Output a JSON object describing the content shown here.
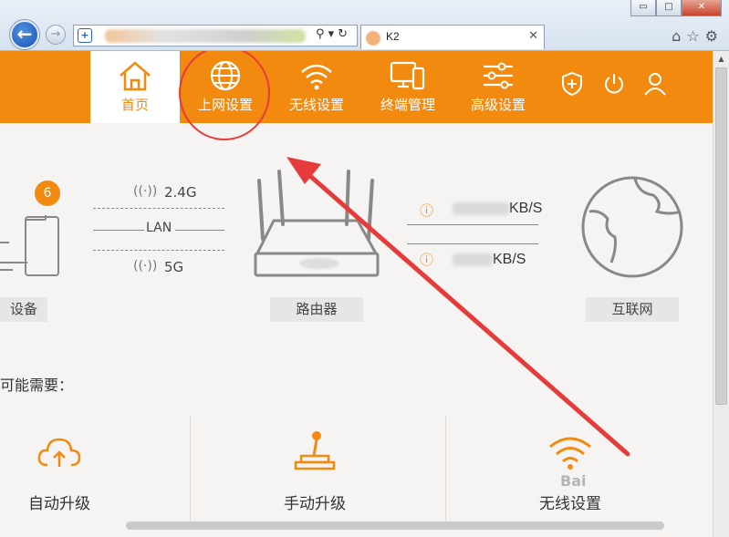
{
  "browser": {
    "tab_title": "K2",
    "tab_close": "✕",
    "win_controls": [
      "▭",
      "□",
      "✕"
    ],
    "toolbar_icons": [
      "⌂",
      "☆",
      "⚙"
    ]
  },
  "nav": {
    "items": [
      {
        "label": "首页",
        "icon": "home-icon"
      },
      {
        "label": "上网设置",
        "icon": "globe-icon"
      },
      {
        "label": "无线设置",
        "icon": "wifi-icon"
      },
      {
        "label": "终端管理",
        "icon": "devices-icon"
      },
      {
        "label": "高级设置",
        "icon": "sliders-icon"
      }
    ],
    "active": "首页",
    "right_icons": [
      "shield-icon",
      "power-icon",
      "user-icon"
    ],
    "accent": "#f18a0f",
    "highlight_color": "#e53b3b"
  },
  "status": {
    "device_count": "6",
    "band_24": "2.4G",
    "band_lan": "LAN",
    "band_5": "5G",
    "devices_label": "设备",
    "router_label": "路由器",
    "internet_label": "互联网",
    "upload_unit": "KB/S",
    "download_unit": "KB/S"
  },
  "tools": {
    "heading": "可能需要：",
    "items": [
      {
        "label": "自动升级",
        "icon": "cloud-upload-icon"
      },
      {
        "label": "手动升级",
        "icon": "joystick-icon"
      },
      {
        "label": "无线设置",
        "icon": "wifi-icon"
      }
    ]
  },
  "watermark": "Bai"
}
